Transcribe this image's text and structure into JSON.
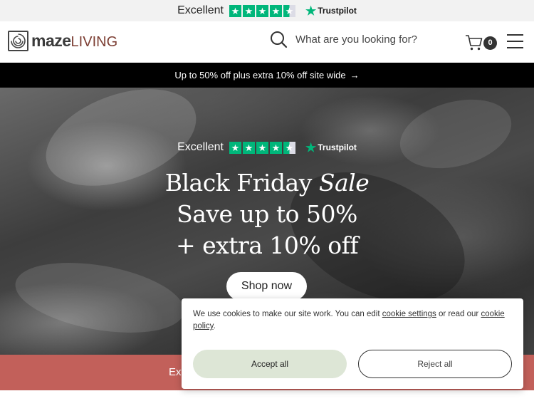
{
  "trustpilot": {
    "rating_text": "Excellent",
    "brand": "Trustpilot",
    "stars": 4.5
  },
  "header": {
    "logo_bold": "maze",
    "logo_light": "LIVING",
    "search_placeholder": "What are you looking for?",
    "cart_count": "0"
  },
  "promo": {
    "text": "Up to 50% off plus extra 10% off site wide",
    "arrow": "→"
  },
  "hero": {
    "tp_rating_text": "Excellent",
    "tp_brand": "Trustpilot",
    "title_line1_plain": "Black Friday ",
    "title_line1_italic": "Sale",
    "title_line2": "Save up to 50%",
    "title_line3": "+ extra 10% off",
    "button_label": "Shop now"
  },
  "strip": {
    "text_partial": "Ext"
  },
  "cookie": {
    "text_before": "We use cookies to make our site work. You can edit ",
    "link1": "cookie settings",
    "text_middle": " or read our ",
    "link2": "cookie policy",
    "text_after": ".",
    "accept_label": "Accept all",
    "reject_label": "Reject all"
  },
  "colors": {
    "trustpilot_green": "#00b67a",
    "promo_bg": "#000000",
    "strip_bg": "#c2605a",
    "accept_bg": "#dde6d6",
    "logo_living": "#7c3e33"
  }
}
